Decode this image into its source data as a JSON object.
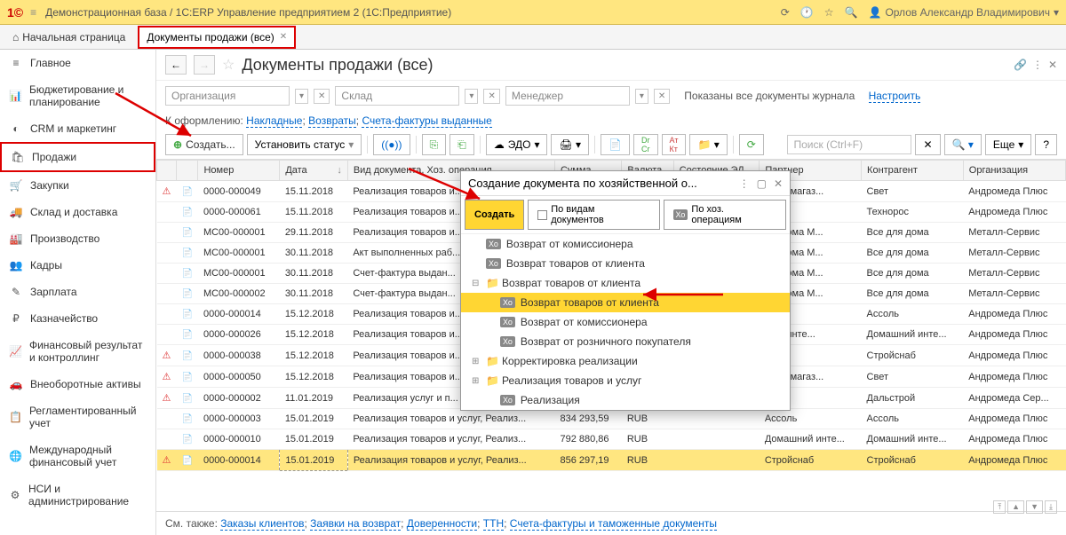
{
  "header": {
    "app_title": "Демонстрационная база / 1С:ERP Управление предприятием 2  (1С:Предприятие)",
    "user_name": "Орлов Александр Владимирович"
  },
  "tabs": {
    "home": "Начальная страница",
    "active": "Документы продажи (все)"
  },
  "sidebar": [
    {
      "icon": "≡",
      "label": "Главное"
    },
    {
      "icon": "📊",
      "label": "Бюджетирование и планирование"
    },
    {
      "icon": "◐",
      "label": "CRM и маркетинг"
    },
    {
      "icon": "🛍",
      "label": "Продажи",
      "highlighted": true
    },
    {
      "icon": "🛒",
      "label": "Закупки"
    },
    {
      "icon": "🚚",
      "label": "Склад и доставка"
    },
    {
      "icon": "🏭",
      "label": "Производство"
    },
    {
      "icon": "👥",
      "label": "Кадры"
    },
    {
      "icon": "✎",
      "label": "Зарплата"
    },
    {
      "icon": "₽",
      "label": "Казначейство"
    },
    {
      "icon": "📈",
      "label": "Финансовый результат и контроллинг"
    },
    {
      "icon": "🚗",
      "label": "Внеоборотные активы"
    },
    {
      "icon": "📋",
      "label": "Регламентированный учет"
    },
    {
      "icon": "🌐",
      "label": "Международный финансовый учет"
    },
    {
      "icon": "⚙",
      "label": "НСИ и администрирование"
    }
  ],
  "content": {
    "title": "Документы продажи (все)",
    "filters": {
      "org_placeholder": "Организация",
      "warehouse_placeholder": "Склад",
      "manager_placeholder": "Менеджер",
      "shown_text": "Показаны все документы журнала",
      "configure": "Настроить"
    },
    "pending": {
      "label": "К оформлению:",
      "links": [
        "Накладные",
        "Возвраты",
        "Счета-фактуры выданные"
      ]
    },
    "toolbar": {
      "create": "Создать...",
      "set_status": "Установить статус",
      "edo": "ЭДО",
      "search_placeholder": "Поиск (Ctrl+F)",
      "more": "Еще"
    },
    "columns": [
      "",
      "",
      "Номер",
      "Дата",
      "Вид документа, Хоз. операция",
      "Сумма",
      "Валюта",
      "Состояние ЭД",
      "Партнер",
      "Контрагент",
      "Организация"
    ],
    "rows": [
      {
        "alert": true,
        "num": "0000-000049",
        "date": "15.11.2018",
        "type": "Реализация товаров и...",
        "sum": "",
        "cur": "",
        "st": "",
        "partner": "...еть магаз...",
        "contr": "Свет",
        "org": "Андромеда Плюс"
      },
      {
        "alert": false,
        "num": "0000-000061",
        "date": "15.11.2018",
        "type": "Реализация товаров и...",
        "sum": "",
        "cur": "",
        "st": "",
        "partner": "",
        "contr": "Технорос",
        "org": "Андромеда Плюс"
      },
      {
        "alert": false,
        "num": "МС00-000001",
        "date": "29.11.2018",
        "type": "Реализация товаров и...",
        "sum": "",
        "cur": "",
        "st": "",
        "partner": "...я дома М...",
        "contr": "Все для дома",
        "org": "Металл-Сервис"
      },
      {
        "alert": false,
        "num": "МС00-000001",
        "date": "30.11.2018",
        "type": "Акт выполненных раб...",
        "sum": "",
        "cur": "",
        "st": "",
        "partner": "...я дома М...",
        "contr": "Все для дома",
        "org": "Металл-Сервис"
      },
      {
        "alert": false,
        "num": "МС00-000001",
        "date": "30.11.2018",
        "type": "Счет-фактура выдан...",
        "sum": "",
        "cur": "",
        "st": "",
        "partner": "...я дома М...",
        "contr": "Все для дома",
        "org": "Металл-Сервис"
      },
      {
        "alert": false,
        "num": "МС00-000002",
        "date": "30.11.2018",
        "type": "Счет-фактура выдан...",
        "sum": "",
        "cur": "",
        "st": "",
        "partner": "...я дома М...",
        "contr": "Все для дома",
        "org": "Металл-Сервис"
      },
      {
        "alert": false,
        "num": "0000-000014",
        "date": "15.12.2018",
        "type": "Реализация товаров и...",
        "sum": "",
        "cur": "",
        "st": "",
        "partner": "",
        "contr": "Ассоль",
        "org": "Андромеда Плюс"
      },
      {
        "alert": false,
        "num": "0000-000026",
        "date": "15.12.2018",
        "type": "Реализация товаров и...",
        "sum": "",
        "cur": "",
        "st": "",
        "partner": "...ий инте...",
        "contr": "Домашний инте...",
        "org": "Андромеда Плюс"
      },
      {
        "alert": true,
        "num": "0000-000038",
        "date": "15.12.2018",
        "type": "Реализация товаров и...",
        "sum": "",
        "cur": "",
        "st": "",
        "partner": "...наб",
        "contr": "Стройснаб",
        "org": "Андромеда Плюс"
      },
      {
        "alert": true,
        "num": "0000-000050",
        "date": "15.12.2018",
        "type": "Реализация товаров и...",
        "sum": "",
        "cur": "",
        "st": "",
        "partner": "...еть магаз...",
        "contr": "Свет",
        "org": "Андромеда Плюс"
      },
      {
        "alert": true,
        "num": "0000-000002",
        "date": "11.01.2019",
        "type": "Реализация услуг и п...",
        "sum": "",
        "cur": "",
        "st": "",
        "partner": "",
        "contr": "Дальстрой",
        "org": "Андромеда Сер..."
      },
      {
        "alert": false,
        "num": "0000-000003",
        "date": "15.01.2019",
        "type": "Реализация товаров и услуг, Реализ...",
        "sum": "834 293,59",
        "cur": "RUB",
        "st": "",
        "partner": "Ассоль",
        "contr": "Ассоль",
        "org": "Андромеда Плюс"
      },
      {
        "alert": false,
        "num": "0000-000010",
        "date": "15.01.2019",
        "type": "Реализация товаров и услуг, Реализ...",
        "sum": "792 880,86",
        "cur": "RUB",
        "st": "",
        "partner": "Домашний инте...",
        "contr": "Домашний инте...",
        "org": "Андромеда Плюс"
      },
      {
        "alert": true,
        "num": "0000-000014",
        "date": "15.01.2019",
        "type": "Реализация товаров и услуг, Реализ...",
        "sum": "856 297,19",
        "cur": "RUB",
        "st": "",
        "partner": "Стройснаб",
        "contr": "Стройснаб",
        "org": "Андромеда Плюс",
        "highlighted": true,
        "date_highlighted": true
      }
    ],
    "footer": {
      "label": "См. также:",
      "links": [
        "Заказы клиентов",
        "Заявки на возврат",
        "Доверенности",
        "ТТН",
        "Счета-фактуры и таможенные документы"
      ]
    }
  },
  "dialog": {
    "title": "Создание документа по хозяйственной о...",
    "create_btn": "Создать",
    "by_doc": "По видам документов",
    "by_op": "По хоз. операциям",
    "items": [
      {
        "type": "leaf",
        "label": "Возврат от комиссионера"
      },
      {
        "type": "leaf",
        "label": "Возврат товаров от клиента"
      },
      {
        "type": "group",
        "label": "Возврат товаров от клиента",
        "expanded": true
      },
      {
        "type": "leaf",
        "label": "Возврат товаров от клиента",
        "indent": true,
        "selected": true
      },
      {
        "type": "leaf",
        "label": "Возврат от комиссионера",
        "indent": true
      },
      {
        "type": "leaf",
        "label": "Возврат от розничного покупателя",
        "indent": true
      },
      {
        "type": "group",
        "label": "Корректировка реализации"
      },
      {
        "type": "group",
        "label": "Реализация товаров и услуг"
      },
      {
        "type": "leaf",
        "label": "Реализация",
        "indent": true
      }
    ]
  }
}
